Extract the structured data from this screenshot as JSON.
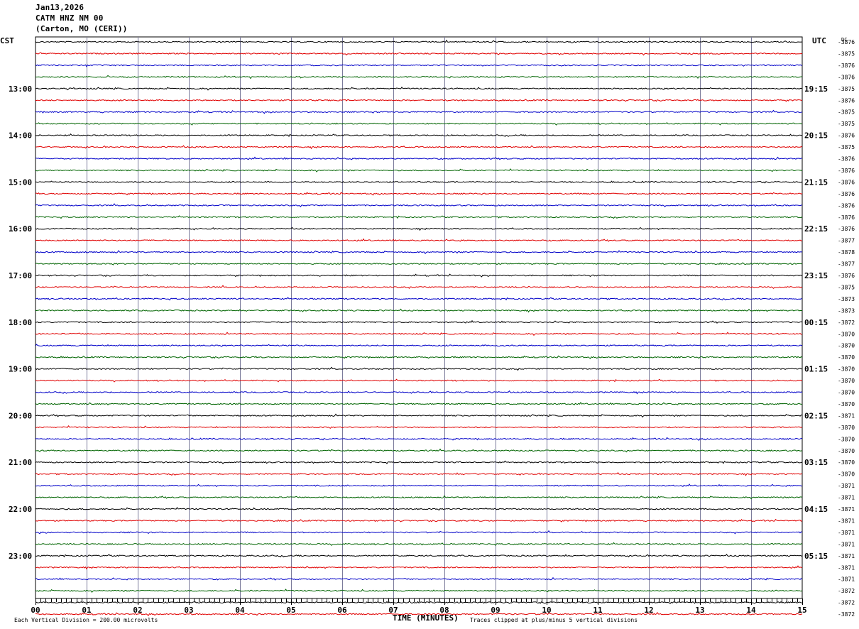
{
  "header": {
    "date": "Jan13,2026",
    "station": "CATM HNZ NM 00",
    "location": "(Carton, MO (CERI))"
  },
  "left_timezone": "CST",
  "right_timezone": "UTC",
  "dc_label": "DC",
  "footer": {
    "scale_note": "Each Vertical Division =  200.00 microvolts",
    "clip_note": "Traces clipped at plus/minus 5 vertical divisions"
  },
  "chart_data": {
    "type": "line",
    "xlabel": "TIME (MINUTES)",
    "x_ticks": [
      "00",
      "01",
      "02",
      "03",
      "04",
      "05",
      "06",
      "07",
      "08",
      "09",
      "10",
      "11",
      "12",
      "13",
      "14",
      "15"
    ],
    "xlim": [
      0,
      15
    ],
    "series_colors": [
      "#000000",
      "#e00000",
      "#0000c8",
      "#006400"
    ],
    "left_hour_labels": [
      "13:00",
      "14:00",
      "15:00",
      "16:00",
      "17:00",
      "18:00",
      "19:00",
      "20:00",
      "21:00",
      "22:00",
      "23:00"
    ],
    "right_hour_labels": [
      "19:15",
      "20:15",
      "21:15",
      "22:15",
      "23:15",
      "00:15",
      "01:15",
      "02:15",
      "03:15",
      "04:15",
      "05:15"
    ],
    "dc_offsets": [
      "-3876",
      "-3875",
      "-3876",
      "-3876",
      "-3875",
      "-3876",
      "-3875",
      "-3875",
      "-3876",
      "-3875",
      "-3876",
      "-3876",
      "-3876",
      "-3876",
      "-3876",
      "-3876",
      "-3876",
      "-3877",
      "-3878",
      "-3877",
      "-3876",
      "-3875",
      "-3873",
      "-3873",
      "-3872",
      "-3870",
      "-3870",
      "-3870",
      "-3870",
      "-3870",
      "-3870",
      "-3870",
      "-3871",
      "-3870",
      "-3870",
      "-3870",
      "-3870",
      "-3870",
      "-3871",
      "-3871",
      "-3871",
      "-3871",
      "-3871",
      "-3871",
      "-3871",
      "-3871",
      "-3871",
      "-3872",
      "-3872",
      "-3872"
    ]
  }
}
